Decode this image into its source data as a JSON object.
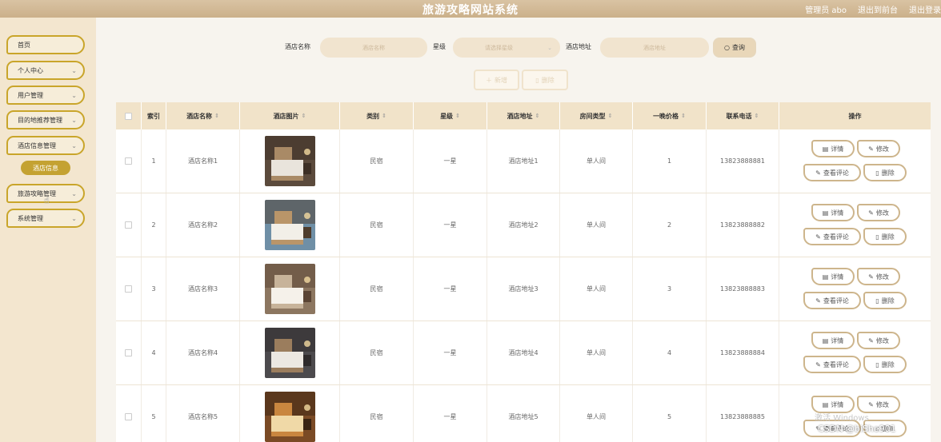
{
  "header": {
    "title": "旅游攻略网站系统",
    "links": [
      "管理员 abo",
      "退出到前台",
      "退出登录"
    ]
  },
  "sidebar": {
    "items": [
      {
        "label": "首页",
        "has_chevron": false
      },
      {
        "label": "个人中心",
        "has_chevron": true
      },
      {
        "label": "用户管理",
        "has_chevron": true
      },
      {
        "label": "目的地推荐管理",
        "has_chevron": true
      },
      {
        "label": "酒店信息管理",
        "has_chevron": true
      },
      {
        "label": "旅游攻略管理",
        "has_chevron": true
      },
      {
        "label": "系统管理",
        "has_chevron": true
      }
    ],
    "sub_item": "酒店信息"
  },
  "search": {
    "hotel_name_label": "酒店名称",
    "hotel_name_placeholder": "酒店名称",
    "star_label": "星级",
    "star_placeholder": "请选择星级",
    "address_label": "酒店地址",
    "address_placeholder": "酒店地址",
    "query_button": "查询"
  },
  "actions": {
    "add": "新增",
    "delete": "删除"
  },
  "table": {
    "columns": [
      "索引",
      "酒店名称",
      "酒店图片",
      "类别",
      "星级",
      "酒店地址",
      "房间类型",
      "一晚价格",
      "联系电话",
      "操作"
    ],
    "rows": [
      {
        "index": "1",
        "name": "酒店名称1",
        "category": "民宿",
        "star": "一星",
        "address": "酒店地址1",
        "room": "单人间",
        "price": "1",
        "phone": "13823888881"
      },
      {
        "index": "2",
        "name": "酒店名称2",
        "category": "民宿",
        "star": "一星",
        "address": "酒店地址2",
        "room": "单人间",
        "price": "2",
        "phone": "13823888882"
      },
      {
        "index": "3",
        "name": "酒店名称3",
        "category": "民宿",
        "star": "一星",
        "address": "酒店地址3",
        "room": "单人间",
        "price": "3",
        "phone": "13823888883"
      },
      {
        "index": "4",
        "name": "酒店名称4",
        "category": "民宿",
        "star": "一星",
        "address": "酒店地址4",
        "room": "单人间",
        "price": "4",
        "phone": "13823888884"
      },
      {
        "index": "5",
        "name": "酒店名称5",
        "category": "民宿",
        "star": "一星",
        "address": "酒店地址5",
        "room": "单人间",
        "price": "5",
        "phone": "13823888885"
      }
    ],
    "row_actions": {
      "detail": "详情",
      "edit": "修改",
      "comments": "查看评论",
      "delete": "删除"
    }
  },
  "overlay": {
    "watermark": "激活 Windows",
    "csdn": "CSDN @biShe901"
  },
  "colors": {
    "accent": "#c9a52a",
    "header": "#d0b48e",
    "sidebar": "#f3e6cf"
  }
}
